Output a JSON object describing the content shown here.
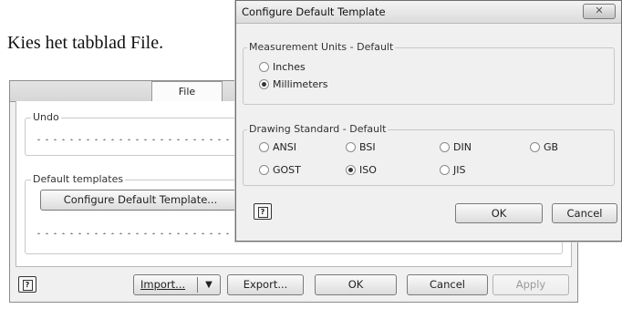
{
  "caption": "Kies het tabblad File.",
  "app": {
    "active_tab": "File",
    "undo_group": "Undo",
    "templates_group": "Default templates",
    "configure_button": "Configure Default Template...",
    "help_label": "?",
    "footer": {
      "import_label": "Import...",
      "import_arrow": "▼",
      "export_label": "Export...",
      "ok_label": "OK",
      "cancel_label": "Cancel",
      "apply_label": "Apply"
    }
  },
  "dialog": {
    "title": "Configure Default Template",
    "close_label": "✕",
    "units_group": "Measurement Units - Default",
    "units": [
      {
        "label": "Inches",
        "selected": false
      },
      {
        "label": "Millimeters",
        "selected": true
      }
    ],
    "standard_group": "Drawing Standard - Default",
    "standards": [
      {
        "label": "ANSI",
        "selected": false
      },
      {
        "label": "BSI",
        "selected": false
      },
      {
        "label": "DIN",
        "selected": false
      },
      {
        "label": "GB",
        "selected": false
      },
      {
        "label": "GOST",
        "selected": false
      },
      {
        "label": "ISO",
        "selected": true
      },
      {
        "label": "JIS",
        "selected": false
      }
    ],
    "help_label": "?",
    "ok_label": "OK",
    "cancel_label": "Cancel"
  }
}
